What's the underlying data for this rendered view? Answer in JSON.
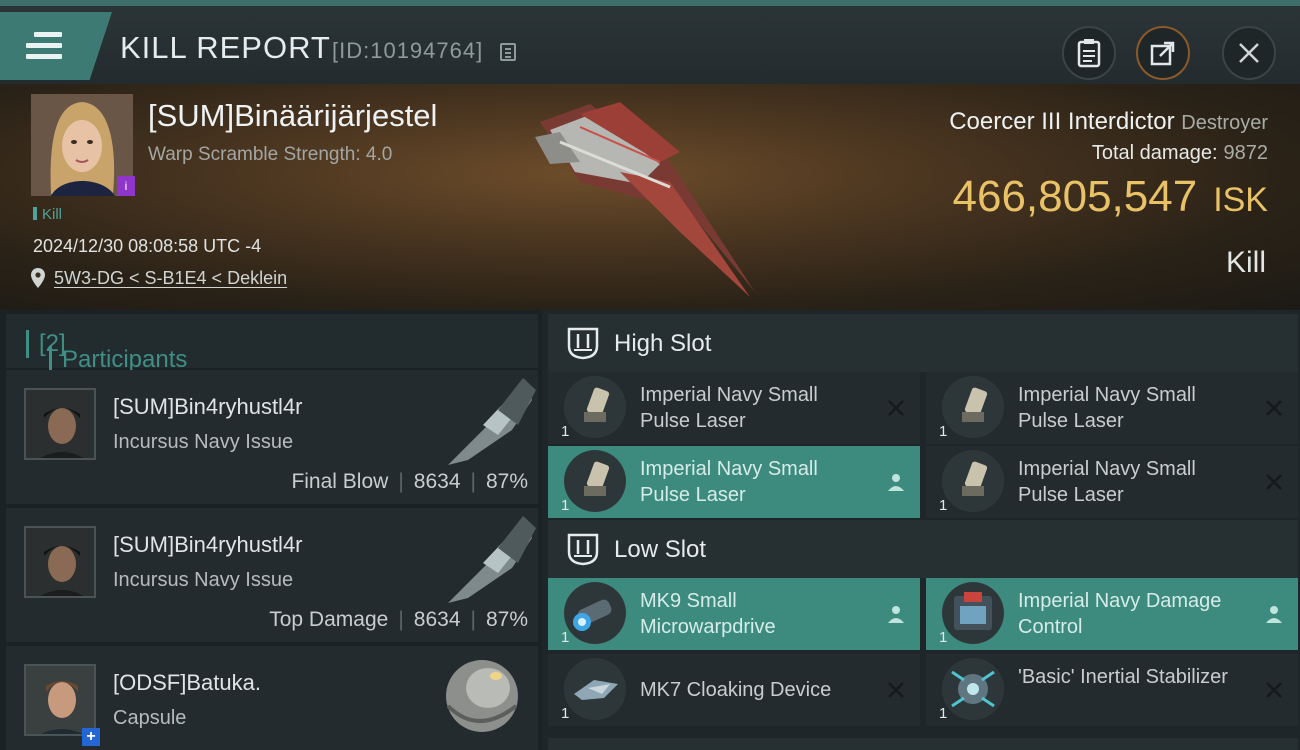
{
  "header": {
    "title": "KILL REPORT",
    "id_text": "[ID:10194764]"
  },
  "victim": {
    "name": "[SUM]Binäärijärjestel",
    "warp_scramble": "Warp Scramble Strength: 4.0",
    "kill_tag": "Kill",
    "datetime": "2024/12/30 08:08:58 UTC -4",
    "location": "5W3-DG < S-B1E4 < Deklein",
    "ship_name": "Coercer III Interdictor",
    "ship_class": "Destroyer",
    "total_damage_label": "Total damage:",
    "total_damage_value": "9872",
    "isk_value": "466,805,547",
    "isk_unit": "ISK",
    "result": "Kill"
  },
  "participants": {
    "title": "Participants",
    "count": "[2]",
    "rows": [
      {
        "name": "[SUM]Bin4ryhustl4r",
        "ship": "Incursus Navy Issue",
        "role": "Final Blow",
        "damage": "8634",
        "percent": "87%"
      },
      {
        "name": "[SUM]Bin4ryhustl4r",
        "ship": "Incursus Navy Issue",
        "role": "Top Damage",
        "damage": "8634",
        "percent": "87%"
      },
      {
        "name": "[ODSF]Batuka.",
        "ship": "Capsule"
      }
    ]
  },
  "fitting": {
    "high_slot_label": "High Slot",
    "low_slot_label": "Low Slot",
    "high_modules": [
      {
        "name": "Imperial Navy Small Pulse Laser",
        "qty": "1",
        "state": "destroyed"
      },
      {
        "name": "Imperial Navy Small Pulse Laser",
        "qty": "1",
        "state": "destroyed"
      },
      {
        "name": "Imperial Navy Small Pulse Laser",
        "qty": "1",
        "state": "dropped"
      },
      {
        "name": "Imperial Navy Small Pulse Laser",
        "qty": "1",
        "state": "destroyed"
      }
    ],
    "low_modules": [
      {
        "name": "MK9 Small Microwarpdrive",
        "qty": "1",
        "state": "dropped"
      },
      {
        "name": "Imperial Navy Damage Control",
        "qty": "1",
        "state": "dropped"
      },
      {
        "name": "MK7 Cloaking Device",
        "qty": "1",
        "state": "destroyed"
      },
      {
        "name": "'Basic' Inertial Stabilizer",
        "qty": "1",
        "state": "destroyed"
      }
    ]
  },
  "colors": {
    "accent_teal": "#3d8a7f",
    "isk_gold": "#e9c268",
    "badge_purple": "#8f35c9",
    "badge_blue": "#2467d4"
  }
}
